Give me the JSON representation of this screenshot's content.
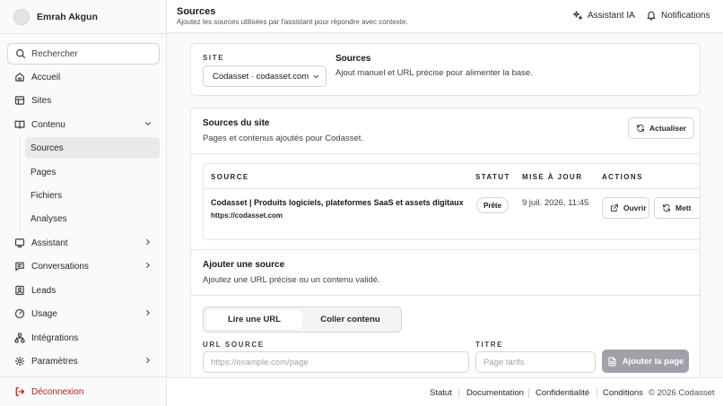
{
  "user": {
    "name": "Emrah Akgun"
  },
  "sidebar": {
    "search_label": "Rechercher",
    "items": [
      {
        "label": "Accueil",
        "icon": "home-icon"
      },
      {
        "label": "Sites",
        "icon": "layout-icon"
      },
      {
        "label": "Contenu",
        "icon": "book-icon",
        "expanded": true
      },
      {
        "label": "Assistant",
        "icon": "monitor-icon"
      },
      {
        "label": "Conversations",
        "icon": "message-icon"
      },
      {
        "label": "Leads",
        "icon": "contact-icon"
      },
      {
        "label": "Usage",
        "icon": "gauge-icon"
      },
      {
        "label": "Intégrations",
        "icon": "network-icon"
      },
      {
        "label": "Paramètres",
        "icon": "gear-icon"
      }
    ],
    "sub_items": [
      {
        "label": "Sources",
        "active": true
      },
      {
        "label": "Pages"
      },
      {
        "label": "Fichiers"
      },
      {
        "label": "Analyses"
      }
    ],
    "logout_label": "Déconnexion"
  },
  "header": {
    "title": "Sources",
    "subtitle": "Ajoutez les sources utilisées par l'assistant pour répondre avec contexte.",
    "assistant_label": "Assistant IA",
    "notifications_label": "Notifications"
  },
  "site_card": {
    "site_label": "SITE",
    "selected_site": "Codasset · codasset.com",
    "title": "Sources",
    "description": "Ajout manuel et URL précise pour alimenter la base."
  },
  "site_sources": {
    "title": "Sources du site",
    "description": "Pages et contenus ajoutés pour Codasset.",
    "refresh_label": "Actualiser",
    "columns": {
      "source": "SOURCE",
      "status": "STATUT",
      "updated": "MISE À JOUR",
      "actions": "ACTIONS"
    },
    "rows": [
      {
        "title": "Codasset | Produits logiciels, plateformes SaaS et assets digitaux",
        "url": "https://codasset.com",
        "status": "Prête",
        "updated": "9 juil. 2026, 11:45",
        "open_label": "Ouvrir",
        "update_label": "Mett"
      }
    ]
  },
  "add_source": {
    "title": "Ajouter une source",
    "description": "Ajoutez une URL précise ou un contenu validé.",
    "tabs": [
      "Lire une URL",
      "Coller contenu"
    ],
    "url_label": "URL SOURCE",
    "url_placeholder": "https://example.com/page",
    "title_label": "TITRE",
    "title_placeholder": "Page tarifs",
    "submit_label": "Ajouter la page"
  },
  "footer": {
    "links": [
      "Statut",
      "Documentation",
      "Confidentialité",
      "Conditions"
    ],
    "copyright": "© 2026 Codasset"
  }
}
